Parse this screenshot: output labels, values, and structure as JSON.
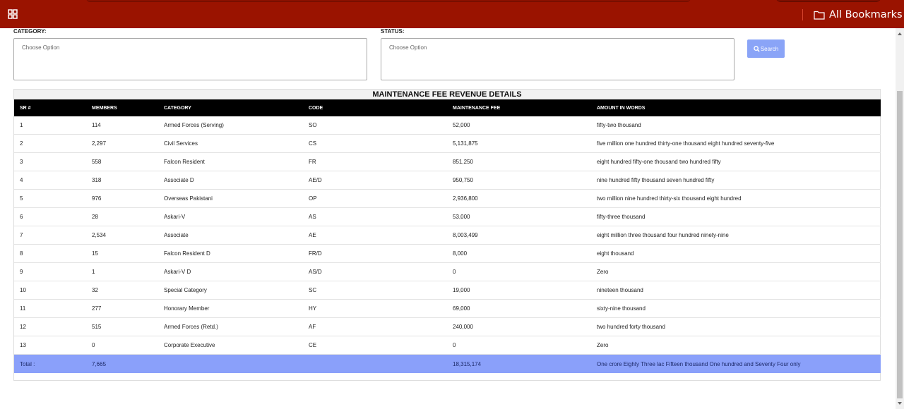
{
  "header": {
    "bookmarks_label": "All Bookmarks",
    "bar_color": "#9a1300"
  },
  "filters": {
    "category": {
      "label": "CATEGORY:",
      "placeholder": "Choose Option"
    },
    "status": {
      "label": "STATUS:",
      "placeholder": "Choose Option"
    },
    "search_label": "Search"
  },
  "table": {
    "title": "MAINTENANCE FEE REVENUE DETAILS",
    "columns": [
      "SR #",
      "MEMBERS",
      "CATEGORY",
      "CODE",
      "MAINTENANCE FEE",
      "AMOUNT IN WORDS"
    ],
    "rows": [
      [
        "1",
        "114",
        "Armed Forces (Serving)",
        "SO",
        "52,000",
        "fifty-two thousand"
      ],
      [
        "2",
        "2,297",
        "Civil Services",
        "CS",
        "5,131,875",
        "five million one hundred thirty-one thousand eight hundred seventy-five"
      ],
      [
        "3",
        "558",
        "Falcon Resident",
        "FR",
        "851,250",
        "eight hundred fifty-one thousand two hundred fifty"
      ],
      [
        "4",
        "318",
        "Associate D",
        "AE/D",
        "950,750",
        "nine hundred fifty thousand seven hundred fifty"
      ],
      [
        "5",
        "976",
        "Overseas Pakistani",
        "OP",
        "2,936,800",
        "two million nine hundred thirty-six thousand eight hundred"
      ],
      [
        "6",
        "28",
        "Askari-V",
        "AS",
        "53,000",
        "fifty-three thousand"
      ],
      [
        "7",
        "2,534",
        "Associate",
        "AE",
        "8,003,499",
        "eight million three thousand four hundred ninety-nine"
      ],
      [
        "8",
        "15",
        "Falcon Resident D",
        "FR/D",
        "8,000",
        "eight thousand"
      ],
      [
        "9",
        "1",
        "Askari-V D",
        "AS/D",
        "0",
        "Zero"
      ],
      [
        "10",
        "32",
        "Special Category",
        "SC",
        "19,000",
        "nineteen thousand"
      ],
      [
        "11",
        "277",
        "Honorary Member",
        "HY",
        "69,000",
        "sixty-nine thousand"
      ],
      [
        "12",
        "515",
        "Armed Forces (Retd.)",
        "AF",
        "240,000",
        "two hundred forty thousand"
      ],
      [
        "13",
        "0",
        "Corporate Executive",
        "CE",
        "0",
        "Zero"
      ]
    ],
    "total": {
      "label": "Total :",
      "members": "7,665",
      "fee": "18,315,174",
      "words": "One crore Eighty Three lac Fifteen thousand One hundred and Seventy Four only"
    }
  }
}
